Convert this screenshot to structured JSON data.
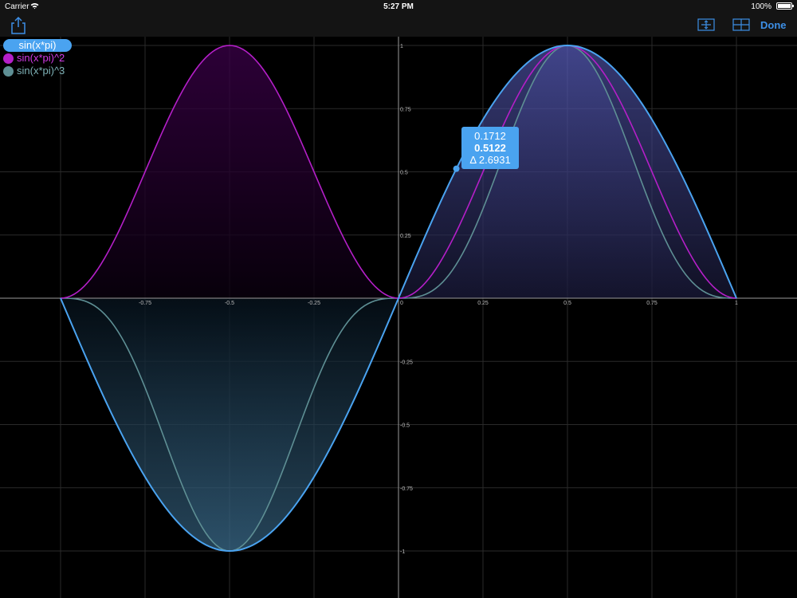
{
  "status": {
    "carrier": "Carrier",
    "time": "5:27 PM",
    "battery": "100%"
  },
  "toolbar": {
    "done_label": "Done"
  },
  "legend": [
    {
      "label": "sin(x*pi)",
      "color": "#4aa3f0",
      "selected": true
    },
    {
      "label": "sin(x*pi)^2",
      "color": "#b41fc8",
      "selected": false
    },
    {
      "label": "sin(x*pi)^3",
      "color": "#5e8f94",
      "selected": false
    }
  ],
  "tooltip": {
    "x": "0.1712",
    "y": "0.5122",
    "delta": "Δ 2.6931"
  },
  "chart_data": {
    "type": "line",
    "xlim": [
      -1,
      1
    ],
    "ylim": [
      -1,
      1
    ],
    "grid": true,
    "x_ticks": [
      "-0.75",
      "-0.5",
      "-0.25",
      "0",
      "0.25",
      "0.5",
      "0.75",
      "1"
    ],
    "y_ticks": [
      "1",
      "0.75",
      "0.5",
      "0.25",
      "-0.25",
      "-0.5",
      "-0.75",
      "-1"
    ],
    "series": [
      {
        "name": "sin(x*pi)",
        "power": 1,
        "color": "#4aa3f0"
      },
      {
        "name": "sin(x*pi)^2",
        "power": 2,
        "color": "#b41fc8"
      },
      {
        "name": "sin(x*pi)^3",
        "power": 3,
        "color": "#5e8f94"
      }
    ],
    "trace_point": {
      "x": 0.1712,
      "y": 0.5122
    }
  }
}
